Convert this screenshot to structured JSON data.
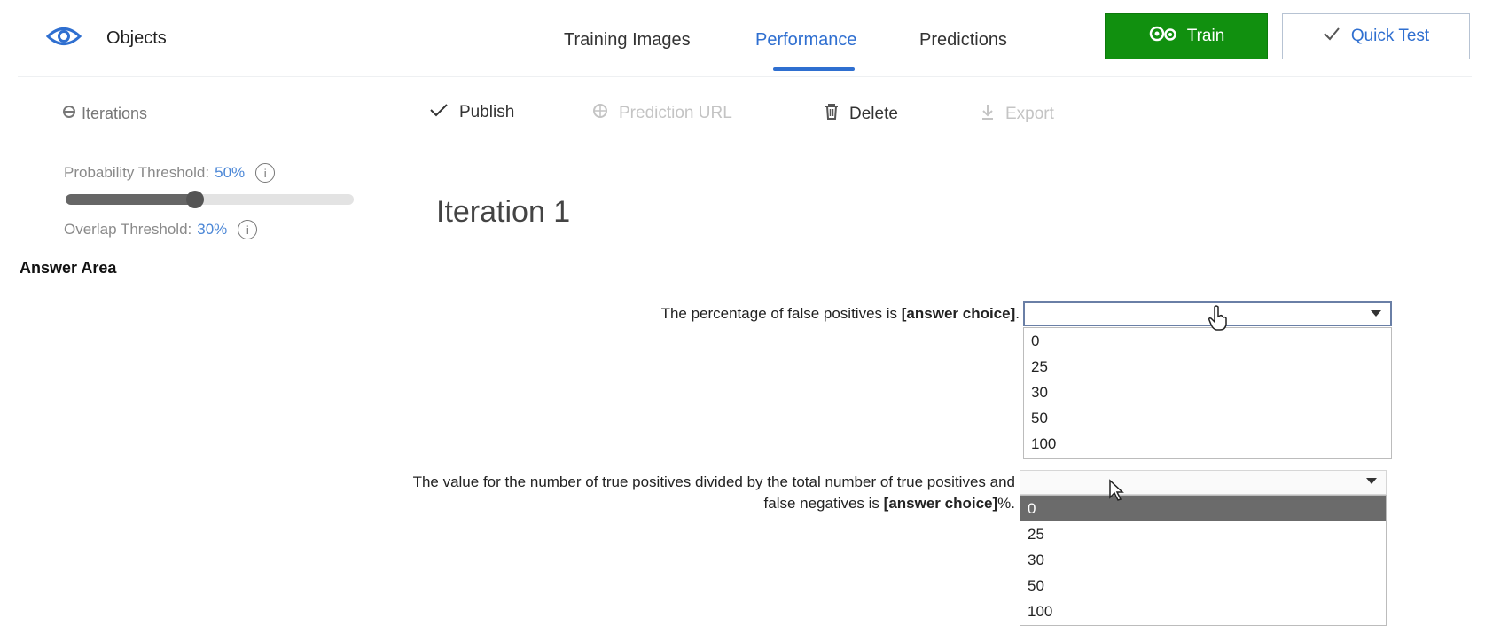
{
  "header": {
    "project_name": "Objects",
    "tabs": [
      {
        "label": "Training Images",
        "active": false
      },
      {
        "label": "Performance",
        "active": true
      },
      {
        "label": "Predictions",
        "active": false
      }
    ],
    "train_label": "Train",
    "quick_test_label": "Quick Test"
  },
  "toolbar": {
    "iterations_label": "Iterations",
    "publish_label": "Publish",
    "prediction_url_label": "Prediction URL",
    "delete_label": "Delete",
    "export_label": "Export"
  },
  "thresholds": {
    "probability_label": "Probability Threshold:",
    "probability_value": "50%",
    "probability_fraction": 0.5,
    "overlap_label": "Overlap Threshold:",
    "overlap_value": "30%"
  },
  "iteration_title": "Iteration 1",
  "answer_area_label": "Answer Area",
  "question1": {
    "text": "The percentage of false positives is ",
    "placeholder": "[answer choice]",
    "suffix": ".",
    "options": [
      "0",
      "25",
      "30",
      "50",
      "100"
    ]
  },
  "question2": {
    "line1": "The value for the number of true positives divided by the total number of true positives and",
    "line2": "false negatives is ",
    "placeholder": "[answer choice]",
    "suffix": "%.",
    "options": [
      "0",
      "25",
      "30",
      "50",
      "100"
    ],
    "highlighted_option": "0"
  },
  "colors": {
    "accent": "#2f6fd0",
    "train_green": "#11900f"
  }
}
